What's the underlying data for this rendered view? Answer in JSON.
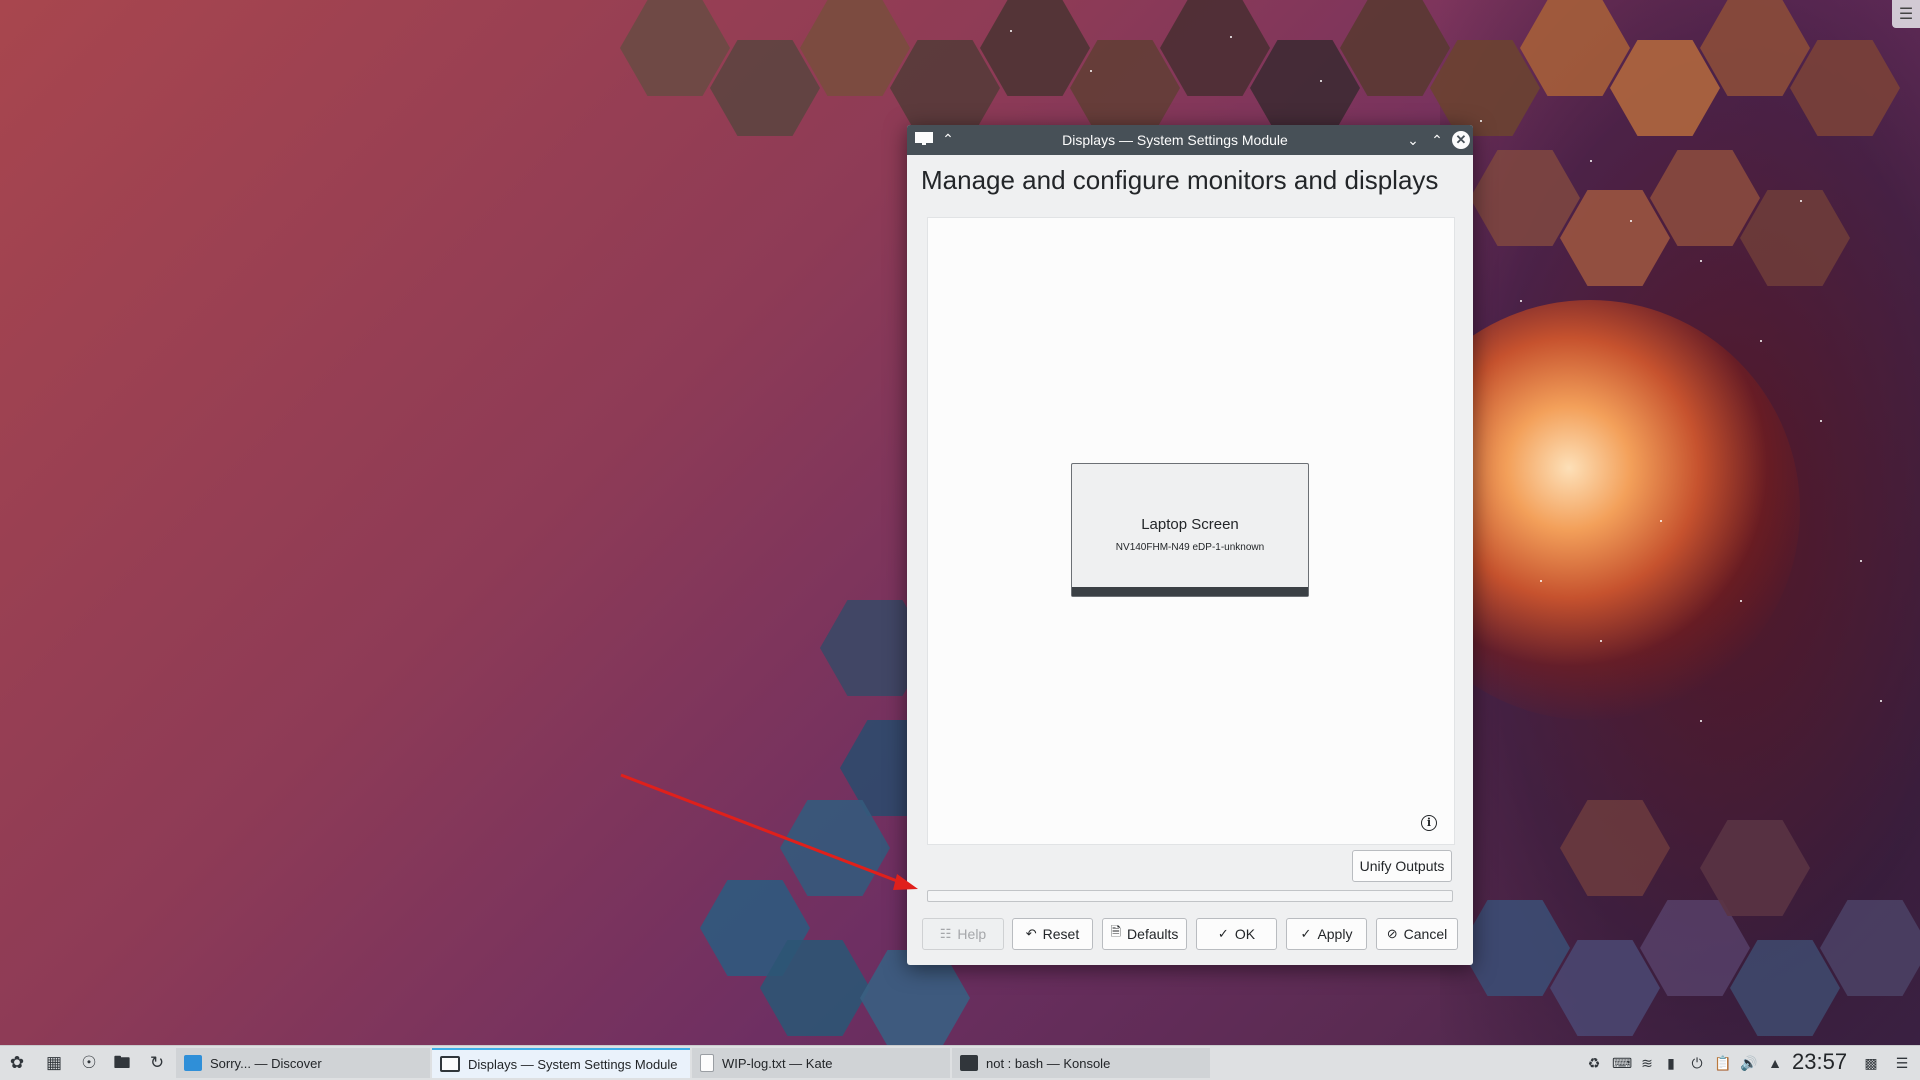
{
  "window": {
    "title": "Displays — System Settings Module",
    "heading": "Manage and configure monitors and displays",
    "output": {
      "name": "Laptop Screen",
      "subtitle": "NV140FHM-N49 eDP-1-unknown"
    },
    "buttons": {
      "unify": "Unify Outputs",
      "help": "Help",
      "reset": "Reset",
      "defaults": "Defaults",
      "ok": "OK",
      "apply": "Apply",
      "cancel": "Cancel"
    }
  },
  "taskbar": {
    "tasks": [
      {
        "label": "Sorry... — Discover",
        "icon": "discover-icon",
        "active": false
      },
      {
        "label": "Displays — System Settings Module",
        "icon": "display-icon",
        "active": true
      },
      {
        "label": "WIP-log.txt — Kate",
        "icon": "text-file-icon",
        "active": false
      },
      {
        "label": "not : bash — Konsole",
        "icon": "terminal-icon",
        "active": false
      }
    ],
    "clock": "23:57"
  },
  "colors": {
    "titlebar": "#475057",
    "accent": "#3daee9",
    "arrow": "#e0201b"
  }
}
